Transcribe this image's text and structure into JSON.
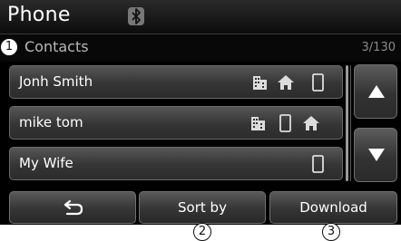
{
  "header": {
    "title": "Phone",
    "bluetooth_icon": "bluetooth-icon"
  },
  "subheader": {
    "label": "Contacts",
    "count": "3/130"
  },
  "markers": [
    "1",
    "2",
    "3"
  ],
  "contacts": [
    {
      "name": "Jonh Smith",
      "icons": [
        "office-icon",
        "home-icon",
        "mobile-icon"
      ]
    },
    {
      "name": "mike tom",
      "icons": [
        "office-icon",
        "mobile-icon",
        "home-icon"
      ]
    },
    {
      "name": "My Wife",
      "icons": [
        "mobile-icon"
      ]
    }
  ],
  "scroll": {
    "up_icon": "arrow-up-icon",
    "down_icon": "arrow-down-icon"
  },
  "bottom_bar": {
    "back_icon": "back-icon",
    "sort_label": "Sort by",
    "download_label": "Download"
  },
  "colors": {
    "background": "#000000",
    "button_gradient_top": "#565656",
    "button_gradient_bottom": "#2c2c2c",
    "text": "#ffffff",
    "label_gray": "#b8b8b8"
  }
}
